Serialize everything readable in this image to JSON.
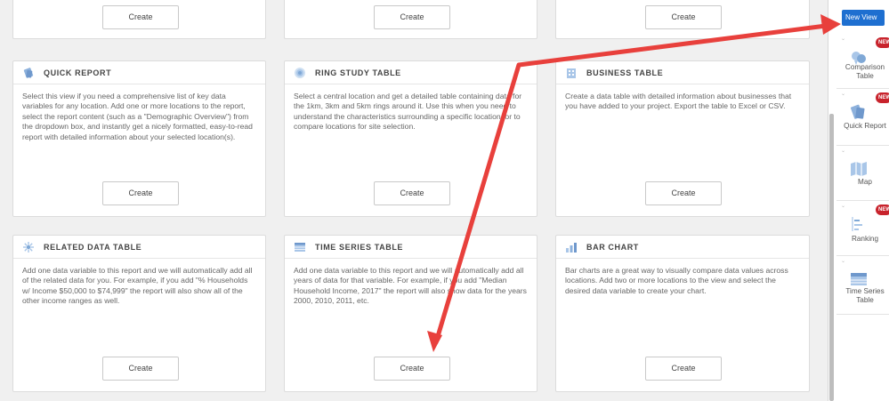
{
  "cards": {
    "top_row": [
      {
        "create": "Create"
      },
      {
        "create": "Create"
      },
      {
        "create": "Create"
      }
    ],
    "quick_report": {
      "title": "QUICK REPORT",
      "desc": "Select this view if you need a comprehensive list of key data variables for any location. Add one or more locations to the report, select the report content (such as a \"Demographic Overview\") from the dropdown box, and instantly get a nicely formatted, easy-to-read report with detailed information about your selected location(s).",
      "create": "Create"
    },
    "ring_study_table": {
      "title": "RING STUDY TABLE",
      "desc": "Select a central location and get a detailed table containing data for the 1km, 3km and 5km rings around it. Use this when you need to understand the characteristics surrounding a specific location, or to compare locations for site selection.",
      "create": "Create"
    },
    "business_table": {
      "title": "BUSINESS TABLE",
      "desc": "Create a data table with detailed information about businesses that you have added to your project. Export the table to Excel or CSV.",
      "create": "Create"
    },
    "related_data_table": {
      "title": "RELATED DATA TABLE",
      "desc": "Add one data variable to this report and we will automatically add all of the related data for you. For example, if you add \"% Households w/ Income $50,000 to $74,999\" the report will also show all of the other income ranges as well.",
      "create": "Create"
    },
    "time_series_table": {
      "title": "TIME SERIES TABLE",
      "desc": "Add one data variable to this report and we will automatically add all years of data for that variable. For example, if you add \"Median Household Income, 2017\" the report will also show data for the years 2000, 2010, 2011, etc.",
      "create": "Create"
    },
    "bar_chart": {
      "title": "BAR CHART",
      "desc": "Bar charts are a great way to visually compare data values across locations. Add two or more locations to the view and select the desired data variable to create your chart.",
      "create": "Create"
    }
  },
  "panel": {
    "new_view_label": "New View",
    "badge": "NEW",
    "items": [
      {
        "label": "Comparison Table",
        "icon": "comparison-table-icon"
      },
      {
        "label": "Quick Report",
        "icon": "quick-report-icon"
      },
      {
        "label": "Map",
        "icon": "map-icon"
      },
      {
        "label": "Ranking",
        "icon": "ranking-icon"
      },
      {
        "label": "Time Series Table",
        "icon": "time-series-icon"
      }
    ]
  },
  "colors": {
    "accent_blue": "#1e6fd0",
    "arrow_red": "#e8403c",
    "badge_red": "#c8232c",
    "icon_blue": "#7fa8d6"
  }
}
